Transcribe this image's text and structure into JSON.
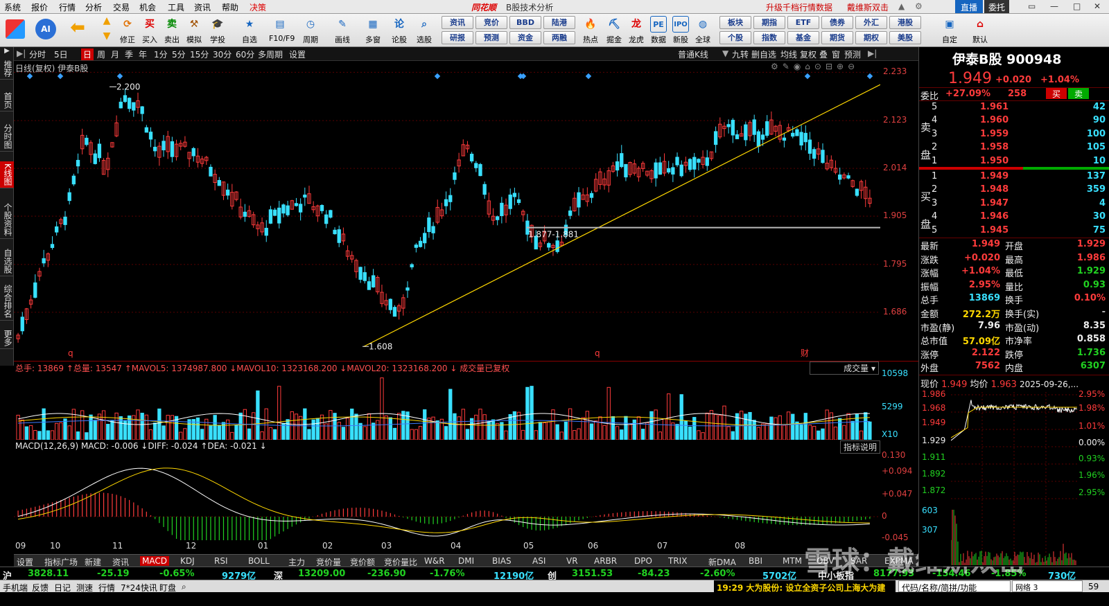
{
  "menu": [
    "系统",
    "报价",
    "行情",
    "分析",
    "交易",
    "机会",
    "工具",
    "资讯",
    "帮助",
    "决策"
  ],
  "app_logo": "同花顺",
  "window_title": "B股技术分析",
  "promo": [
    "升级千档行情数据",
    "戴维斯双击"
  ],
  "live_btn": "直播",
  "account": "委托",
  "toolbar": [
    {
      "label": "修正",
      "icon": "refresh-icon"
    },
    {
      "label": "买入",
      "icon": "buy-icon"
    },
    {
      "label": "卖出",
      "icon": "sell-icon"
    },
    {
      "label": "模拟",
      "icon": "hammer-icon"
    },
    {
      "label": "学投资",
      "icon": "graduation-icon"
    },
    {
      "label": "自选",
      "icon": "star-icon"
    },
    {
      "label": "F10/F9",
      "icon": "info-icon"
    },
    {
      "label": "周期",
      "icon": "clock-icon"
    },
    {
      "label": "画线",
      "icon": "pen-icon"
    },
    {
      "label": "多窗",
      "icon": "windows-icon"
    },
    {
      "label": "论股",
      "icon": "chat-icon"
    },
    {
      "label": "选股",
      "icon": "magnifier-icon"
    }
  ],
  "toolbar2": [
    {
      "label": "热点",
      "icon": "fire-icon"
    },
    {
      "label": "掘金",
      "icon": "gold-icon"
    },
    {
      "label": "龙虎",
      "icon": "dragon-icon"
    },
    {
      "label": "数据",
      "icon": "pe-icon"
    },
    {
      "label": "新股",
      "icon": "ipo-icon"
    },
    {
      "label": "全球",
      "icon": "globe-icon"
    },
    {
      "label": "自定",
      "icon": "custom-icon"
    },
    {
      "label": "默认",
      "icon": "home-icon"
    }
  ],
  "pills": [
    [
      "资讯",
      "研报"
    ],
    [
      "竞价",
      "预测"
    ],
    [
      "BBD",
      "资金"
    ],
    [
      "陆港",
      "两融"
    ],
    [
      "板块",
      "个股"
    ],
    [
      "期指",
      "指数"
    ],
    [
      "ETF",
      "基金"
    ],
    [
      "债券",
      "期货"
    ],
    [
      "外汇",
      "期权"
    ],
    [
      "港股",
      "美股"
    ]
  ],
  "leftnav": [
    "推荐",
    "首页",
    "分时图",
    "K线图",
    "个股资料",
    "自选股",
    "综合排名",
    "更多"
  ],
  "periods": [
    "分时",
    "5日",
    "日",
    "周",
    "月",
    "季",
    "年",
    "1分",
    "5分",
    "15分",
    "30分",
    "60分",
    "多周期",
    "设置"
  ],
  "period_active": "日",
  "kline_type": "普通K线",
  "kline_opts": [
    "九转",
    "删自选",
    "均线",
    "复权",
    "叠",
    "窗",
    "预测"
  ],
  "stock_label": "日线(复权)  伊泰B股",
  "chart_data": {
    "type": "candlestick",
    "ylim": [
      1.58,
      2.24
    ],
    "y_ticks": [
      1.686,
      1.795,
      1.905,
      2.014,
      2.123,
      2.233
    ],
    "x_months": [
      "09",
      "10",
      "11",
      "12",
      "01",
      "02",
      "03",
      "04",
      "05",
      "06",
      "07",
      "08"
    ],
    "annotations": [
      {
        "text": "2.200"
      },
      {
        "text": "1.608"
      },
      {
        "text": "1.877-1.881"
      }
    ],
    "markers": [
      "q",
      "q",
      "财"
    ]
  },
  "vol": {
    "header": "总手: 13869 ↑总量: 13547  ↑MAVOL5: 1374987.800  ↓MAVOL10: 1323168.200  ↓MAVOL20: 1323168.200  ↓ 成交量已复权",
    "selector": "成交量",
    "ticks": [
      "10598",
      "5299",
      "X10"
    ]
  },
  "macd": {
    "header": "MACD(12,26,9)  MACD: -0.006  ↓DIFF: -0.024  ↑DEA: -0.021  ↓",
    "btn": "指标说明",
    "ticks": [
      "0.130",
      "+0.094",
      "+0.047",
      "0",
      "-0.045"
    ]
  },
  "indicators": [
    "设置",
    "指标广场",
    "新建",
    "资讯",
    "MACD",
    "KDJ",
    "RSI",
    "BOLL",
    "主力",
    "竞价量",
    "竞价额",
    "竞价量比",
    "W&R",
    "DMI",
    "BIAS",
    "ASI",
    "VR",
    "ARBR",
    "DPO",
    "TRIX",
    "新DMA",
    "BBI",
    "MTM",
    "OBV",
    "SAR",
    "EXPMA"
  ],
  "indicator_active": "MACD",
  "indexbar": {
    "sh": {
      "name": "沪",
      "val": "3828.11",
      "chg": "-25.19",
      "pct": "-0.65%",
      "amt": "9279亿"
    },
    "sz": {
      "name": "深",
      "val": "13209.00",
      "chg": "-236.90",
      "pct": "-1.76%",
      "amt": "12190亿"
    },
    "cy": {
      "name": "创",
      "val": "3151.53",
      "chg": "-84.23",
      "pct": "-2.60%",
      "amt": "5702亿"
    },
    "zx": {
      "name": "中小板指",
      "val": "8177.93",
      "chg": "-154.46",
      "pct": "-1.85%",
      "amt": "730亿"
    }
  },
  "statusbar": [
    "手机端",
    "反馈",
    "日记",
    "测速",
    "行情",
    "7*24快讯",
    "盯盘"
  ],
  "news": "19:29 大为股份: 设立全资子公司上海大为建",
  "codebox": "代码/名称/简拼/功能",
  "net": "网络 3",
  "clock": "59",
  "watermark": "雪球：戴维斯双击",
  "quote": {
    "name": "伊泰B股",
    "code": "900948",
    "price": "1.949",
    "chg": "+0.020",
    "pct": "+1.04%",
    "wb_label": "委比",
    "wb": "+27.09%",
    "wc": "258",
    "buy_btn": "买",
    "sell_btn": "卖",
    "asks": [
      [
        "5",
        "1.961",
        "42"
      ],
      [
        "4",
        "1.960",
        "90"
      ],
      [
        "3",
        "1.959",
        "100"
      ],
      [
        "2",
        "1.958",
        "105"
      ],
      [
        "1",
        "1.950",
        "10"
      ]
    ],
    "ask_label": [
      "卖",
      "盘"
    ],
    "bids": [
      [
        "1",
        "1.949",
        "137"
      ],
      [
        "2",
        "1.948",
        "359"
      ],
      [
        "3",
        "1.947",
        "4"
      ],
      [
        "4",
        "1.946",
        "30"
      ],
      [
        "5",
        "1.945",
        "75"
      ]
    ],
    "bid_label": [
      "买",
      "盘"
    ],
    "stats": [
      [
        "最新",
        "1.949",
        "开盘",
        "1.929"
      ],
      [
        "涨跌",
        "+0.020",
        "最高",
        "1.986"
      ],
      [
        "涨幅",
        "+1.04%",
        "最低",
        "1.929"
      ],
      [
        "振幅",
        "2.95%",
        "量比",
        "0.93"
      ],
      [
        "总手",
        "13869",
        "换手",
        "0.10%"
      ],
      [
        "金额",
        "272.2万",
        "换手(实)",
        "-"
      ],
      [
        "市盈(静)",
        "7.96",
        "市盈(动)",
        "8.35"
      ],
      [
        "总市值",
        "57.09亿",
        "市净率",
        "0.858"
      ],
      [
        "涨停",
        "2.122",
        "跌停",
        "1.736"
      ],
      [
        "外盘",
        "7562",
        "内盘",
        "6307"
      ]
    ],
    "mini_header": [
      "现价",
      "1.949",
      "均价",
      "1.963",
      "2025-09-26,..."
    ],
    "mini_left": [
      "1.986",
      "1.968",
      "1.949",
      "1.929",
      "1.911",
      "1.892",
      "1.872",
      "603",
      "307"
    ],
    "mini_right": [
      "2.95%",
      "1.98%",
      "1.01%",
      "0.00%",
      "0.93%",
      "1.96%",
      "2.95%"
    ]
  }
}
